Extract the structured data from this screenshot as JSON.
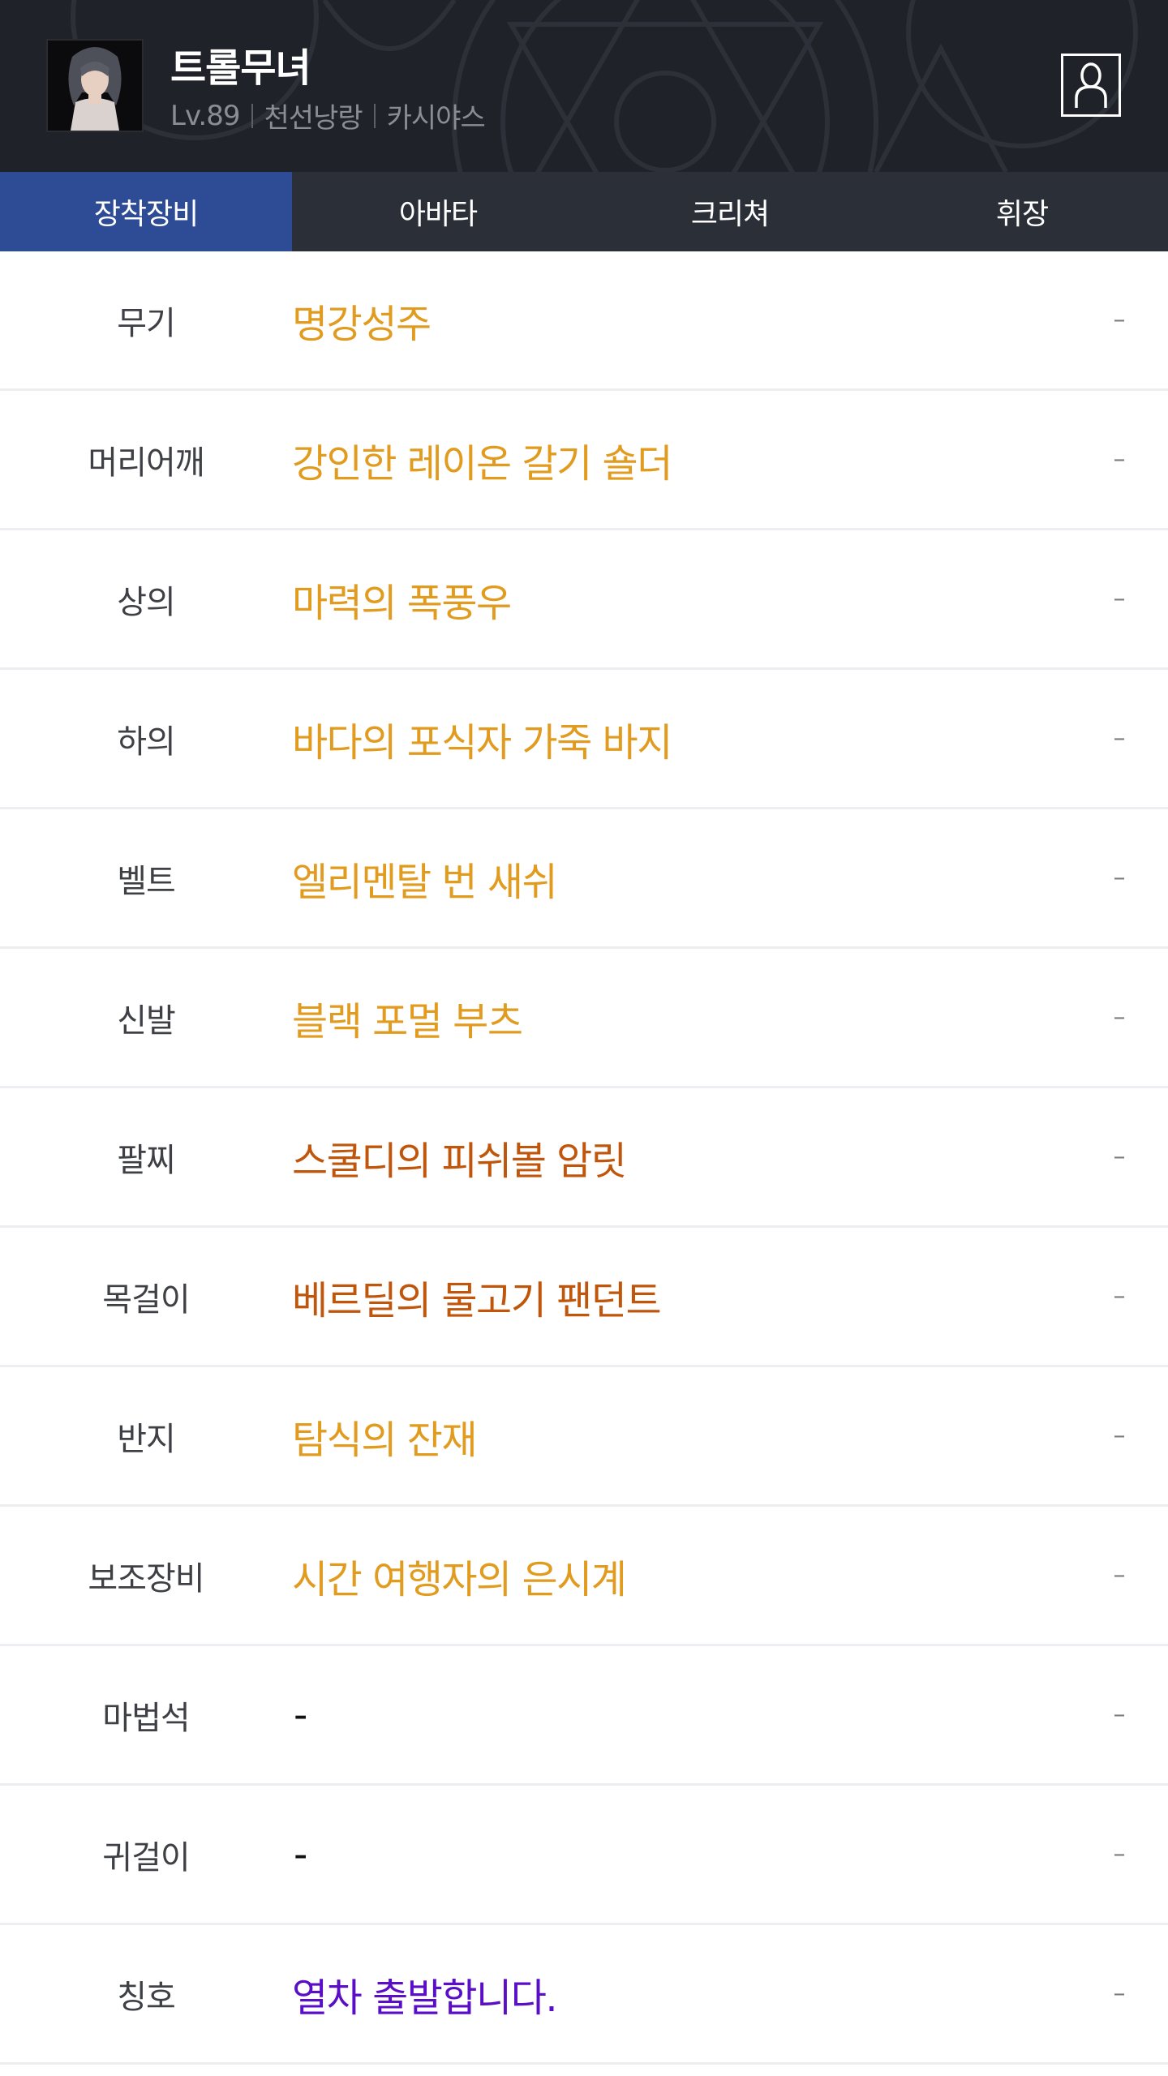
{
  "header": {
    "character_name": "트롤무녀",
    "level": "Lv.89",
    "class": "천선낭랑",
    "server": "카시야스"
  },
  "tabs": [
    {
      "label": "장착장비",
      "active": true
    },
    {
      "label": "아바타",
      "active": false
    },
    {
      "label": "크리쳐",
      "active": false
    },
    {
      "label": "휘장",
      "active": false
    }
  ],
  "equipment": [
    {
      "slot": "무기",
      "item": "명강성주",
      "color": "#e19b1e",
      "action": "–"
    },
    {
      "slot": "머리어깨",
      "item": "강인한 레이온 갈기 숄더",
      "color": "#e19b1e",
      "action": "–"
    },
    {
      "slot": "상의",
      "item": "마력의 폭풍우",
      "color": "#e19b1e",
      "action": "–"
    },
    {
      "slot": "하의",
      "item": "바다의 포식자 가죽 바지",
      "color": "#e19b1e",
      "action": "–"
    },
    {
      "slot": "벨트",
      "item": "엘리멘탈 번 새쉬",
      "color": "#e19b1e",
      "action": "–"
    },
    {
      "slot": "신발",
      "item": "블랙 포멀 부츠",
      "color": "#e19b1e",
      "action": "–"
    },
    {
      "slot": "팔찌",
      "item": "스쿨디의 피쉬볼 암릿",
      "color": "#c0560c",
      "action": "–"
    },
    {
      "slot": "목걸이",
      "item": "베르딜의 물고기 팬던트",
      "color": "#c0560c",
      "action": "–"
    },
    {
      "slot": "반지",
      "item": "탐식의 잔재",
      "color": "#e19b1e",
      "action": "–"
    },
    {
      "slot": "보조장비",
      "item": "시간 여행자의 은시계",
      "color": "#e19b1e",
      "action": "–"
    },
    {
      "slot": "마법석",
      "item": "-",
      "color": "#111111",
      "action": "–"
    },
    {
      "slot": "귀걸이",
      "item": "-",
      "color": "#111111",
      "action": "–"
    },
    {
      "slot": "칭호",
      "item": "열차 출발합니다.",
      "color": "#5a0fc7",
      "action": "–"
    }
  ],
  "colors": {
    "header_bg": "#1f2228",
    "tab_bar_bg": "#2b2f38",
    "tab_active_bg": "#2e4b96"
  },
  "icons": {
    "profile": "person-outline-icon",
    "portrait": "character-portrait"
  }
}
